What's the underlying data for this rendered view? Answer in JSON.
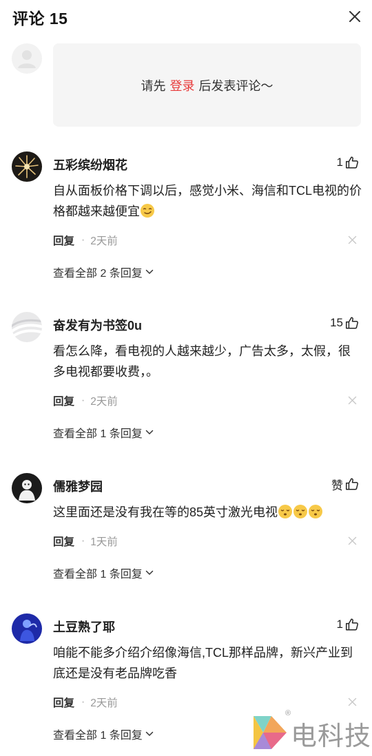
{
  "header": {
    "title": "评论 15"
  },
  "login_prompt": {
    "prefix": "请先",
    "link": "登录",
    "suffix": "后发表评论～"
  },
  "comments": [
    {
      "username": "五彩缤纷烟花",
      "likes": "1",
      "text": "自从面板价格下调以后，感觉小米、海信和TCL电视的价格都越来越便宜",
      "emoji": "smirk-emoji",
      "reply_label": "回复",
      "time": "2天前",
      "view_replies": "查看全部 2 条回复"
    },
    {
      "username": "奋发有为书签0u",
      "likes": "15",
      "text": "看怎么降，看电视的人越来越少，广告太多，太假，很多电视都要收费，。",
      "reply_label": "回复",
      "time": "2天前",
      "view_replies": "查看全部 1 条回复"
    },
    {
      "username": "儒雅梦园",
      "likes": "赞",
      "text": "这里面还是没有我在等的85英寸激光电视",
      "emoji": "sleepy-emoji",
      "emoji_count": 3,
      "reply_label": "回复",
      "time": "1天前",
      "view_replies": "查看全部 1 条回复"
    },
    {
      "username": "土豆熟了耶",
      "likes": "1",
      "text": "咱能不能多介绍介绍像海信,TCL那样品牌，新兴产业到底还是没有老品牌吃香",
      "reply_label": "回复",
      "time": "2天前",
      "view_replies": "查看全部 1 条回复"
    }
  ],
  "watermark": {
    "text": "电科技",
    "registered": "®"
  },
  "colors": {
    "accent_red": "#e83a3a",
    "muted_text": "#999999",
    "login_box_bg": "#f5f5f5"
  }
}
